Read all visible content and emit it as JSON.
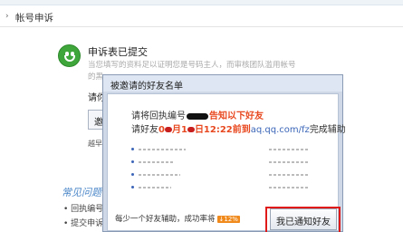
{
  "header": {
    "tab_label": "帐号申诉",
    "arrow": "›"
  },
  "status": {
    "heading": "申诉表已提交",
    "desc_line1": "当您填写的资料足以证明您是号码主人，而审核团队滥用帐号",
    "desc_line2": "的黑",
    "ask": "请你",
    "button_label": "邀",
    "small_note": "越早完"
  },
  "faq": {
    "title": "常见问题",
    "items": [
      "• 回执编号",
      "• 提交申诉"
    ]
  },
  "dialog": {
    "title": "被邀请的好友名单",
    "line1_prefix": "请将回执编号",
    "line1_highlight": "告知以下好友",
    "line2_prefix": "请好友",
    "line2_date_m": "0",
    "line2_date_mid": "月",
    "line2_date_d": "1",
    "line2_date_rest": "日12:22前到",
    "line2_url": "aq.qq.com/fz",
    "line2_suffix": "完成辅助",
    "footer_text": "每少一个好友辅助，成功率将",
    "footer_badge": "↓12%",
    "notify_button": "我已通知好友"
  },
  "colors": {
    "accent_red": "#e8481f",
    "link_blue": "#3b66b8",
    "faq_blue": "#4a86c8",
    "highlight_red": "#e01919"
  }
}
